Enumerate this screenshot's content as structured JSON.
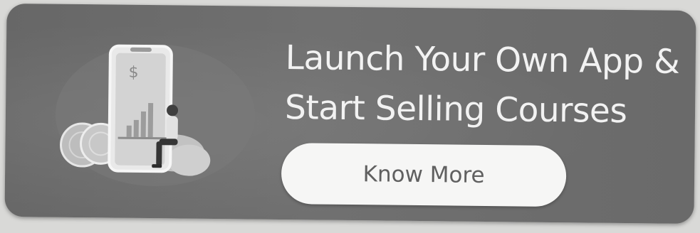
{
  "banner": {
    "headline_line1": "Launch Your Own App &",
    "headline_line2": "Start Selling Courses",
    "cta_label": "Know More",
    "phone_symbol": "$"
  },
  "colors": {
    "banner_bg": "#6b6b6b",
    "headline_text": "#f2f2f2",
    "cta_bg": "#f6f6f5",
    "cta_text": "#606060"
  },
  "icons": [
    "phone-illustration-icon",
    "coin-stack-icon",
    "bar-chart-icon",
    "person-sitting-icon",
    "cloud-blob-icon"
  ]
}
